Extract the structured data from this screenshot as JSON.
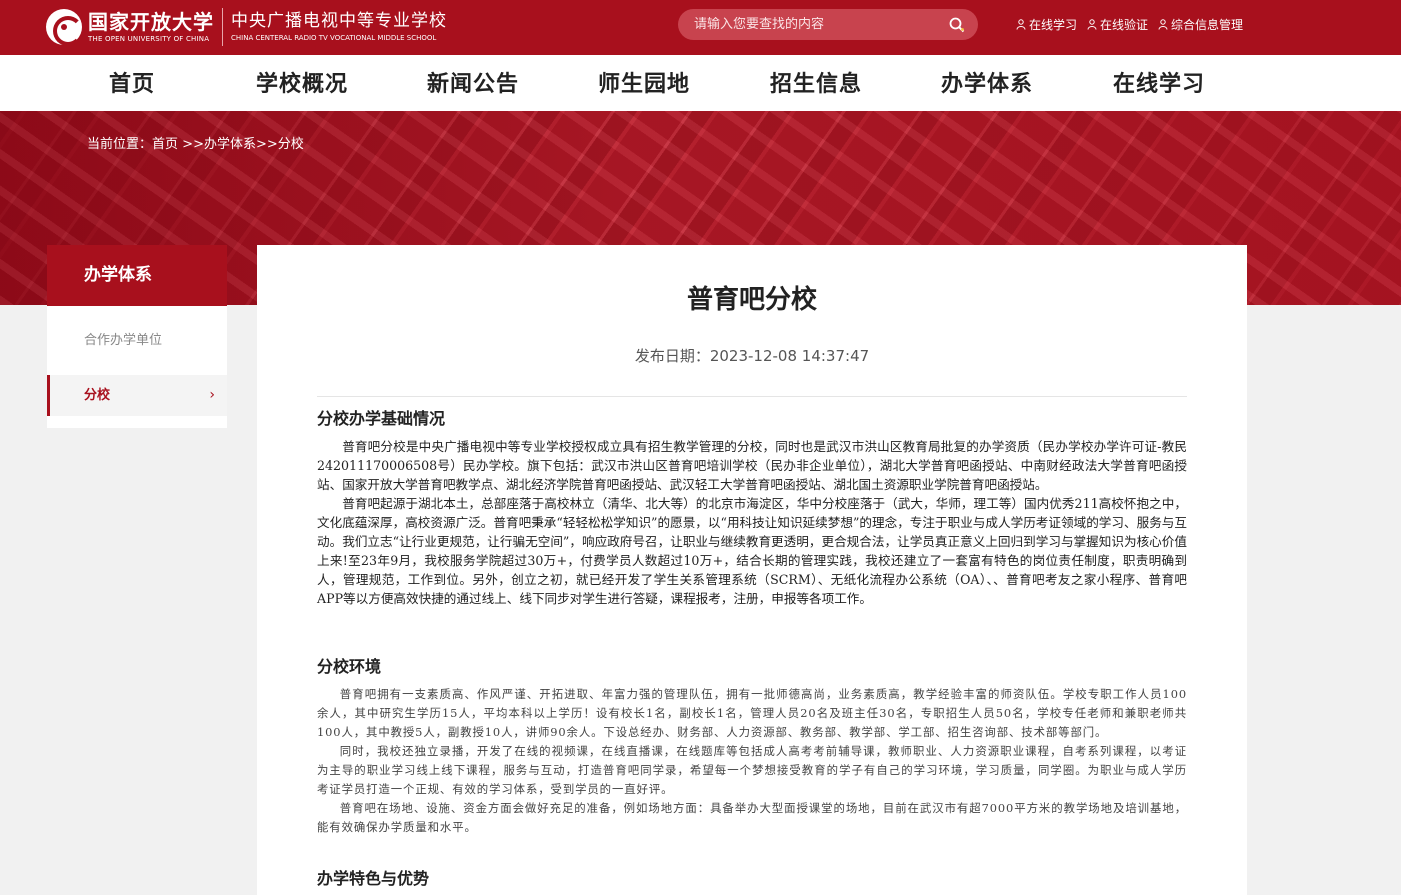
{
  "header": {
    "logo_main": "国家开放大学",
    "logo_main_en": "THE OPEN UNIVERSITY OF CHINA",
    "logo_sub": "中央广播电视中等专业学校",
    "logo_sub_en": "CHINA CENTERAL RADIO TV VOCATIONAL MIDDLE SCHOOL",
    "search_placeholder": "请输入您要查找的内容",
    "links": [
      "在线学习",
      "在线验证",
      "综合信息管理"
    ],
    "accent": "#a8101d"
  },
  "nav": [
    "首页",
    "学校概况",
    "新闻公告",
    "师生园地",
    "招生信息",
    "办学体系",
    "在线学习"
  ],
  "breadcrumb": {
    "prefix": "当前位置：",
    "home": "首页",
    "sep1": ">>",
    "level1": "办学体系",
    "sep2": ">>",
    "level2": "分校"
  },
  "sidebar": {
    "title": "办学体系",
    "items": [
      "合作办学单位",
      "分校"
    ],
    "active_index": 1,
    "arrow": "›"
  },
  "article": {
    "title": "普育吧分校",
    "date_label": "发布日期：",
    "date_value": "2023-12-08 14:37:47",
    "sections": [
      {
        "heading": "分校办学基础情况",
        "paragraphs": [
          "普育吧分校是中央广播电视中等专业学校授权成立具有招生教学管理的分校，同时也是武汉市洪山区教育局批复的办学资质（民办学校办学许可证-教民242011170006508号）民办学校。旗下包括：武汉市洪山区普育吧培训学校（民办非企业单位），湖北大学普育吧函授站、中南财经政法大学普育吧函授站、国家开放大学普育吧教学点、湖北经济学院普育吧函授站、武汉轻工大学普育吧函授站、湖北国土资源职业学院普育吧函授站。",
          "普育吧起源于湖北本土，总部座落于高校林立（清华、北大等）的北京市海淀区，华中分校座落于（武大，华师，理工等）国内优秀211高校怀抱之中，文化底蕴深厚，高校资源广泛。普育吧秉承“轻轻松松学知识”的愿景，以“用科技让知识延续梦想”的理念，专注于职业与成人学历考证领域的学习、服务与互动。我们立志“让行业更规范，让行骗无空间”，响应政府号召，让职业与继续教育更透明，更合规合法，让学员真正意义上回归到学习与掌握知识为核心价值上来!至23年9月，我校服务学院超过30万+，付费学员人数超过10万+，结合长期的管理实践，我校还建立了一套富有特色的岗位责任制度，职责明确到人，管理规范，工作到位。另外，创立之初，就已经开发了学生关系管理系统（SCRM）、无纸化流程办公系统（OA）、、普育吧考友之家小程序、普育吧APP等以方便高效快捷的通过线上、线下同步对学生进行答疑，课程报考，注册，申报等各项工作。"
        ]
      },
      {
        "heading": "分校环境",
        "paragraphs": [
          "普育吧拥有一支素质高、作风严谨、开拓进取、年富力强的管理队伍，拥有一批师德高尚，业务素质高，教学经验丰富的师资队伍。学校专职工作人员100余人，其中研究生学历15人，平均本科以上学历！设有校长1名，副校长1名，管理人员20名及班主任30名，专职招生人员50名，学校专任老师和兼职老师共100人，其中教授5人，副教授10人，讲师90余人。下设总经办、财务部、人力资源部、教务部、教学部、学工部、招生咨询部、技术部等部门。",
          "同时，我校还独立录播，开发了在线的视频课，在线直播课，在线题库等包括成人高考考前辅导课，教师职业、人力资源职业课程，自考系列课程，以考证为主导的职业学习线上线下课程，服务与互动，打造普育吧同学录，希望每一个梦想接受教育的学子有自己的学习环境，学习质量，同学圈。为职业与成人学历考证学员打造一个正规、有效的学习体系，受到学员的一直好评。",
          "普育吧在场地、设施、资金方面会做好充足的准备，例如场地方面：具备举办大型面授课堂的场地，目前在武汉市有超7000平方米的教学场地及培训基地，能有效确保办学质量和水平。"
        ]
      },
      {
        "heading": "办学特色与优势",
        "paragraphs": []
      }
    ]
  }
}
